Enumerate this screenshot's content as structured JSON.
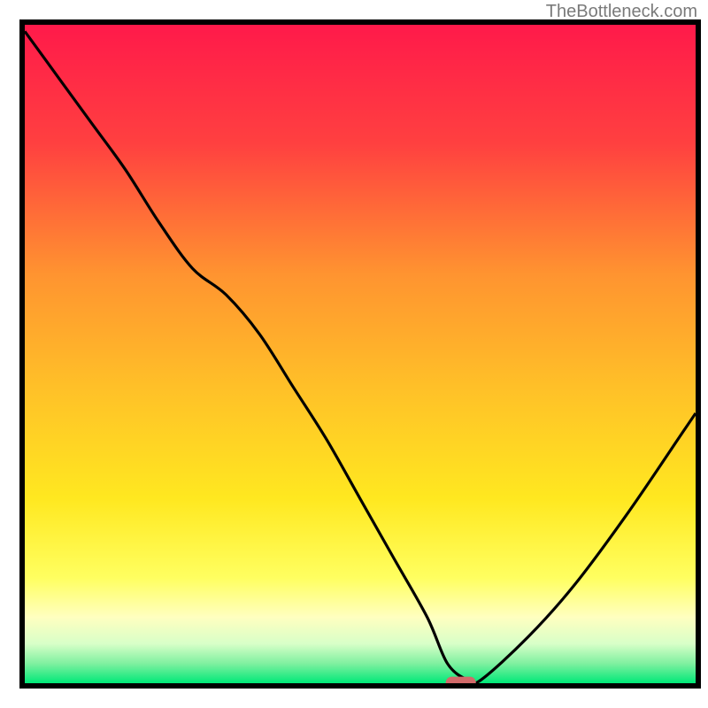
{
  "watermark": "TheBottleneck.com",
  "chart_data": {
    "type": "line",
    "title": "",
    "xlabel": "",
    "ylabel": "",
    "xlim": [
      0,
      100
    ],
    "ylim": [
      0,
      100
    ],
    "background": {
      "type": "vertical-gradient",
      "description": "Red at top through orange, yellow, light-yellow to green band at bottom",
      "stops": [
        {
          "pos": 0.0,
          "color": "#ff1a4a"
        },
        {
          "pos": 0.18,
          "color": "#ff4040"
        },
        {
          "pos": 0.38,
          "color": "#ff9430"
        },
        {
          "pos": 0.55,
          "color": "#ffc028"
        },
        {
          "pos": 0.72,
          "color": "#ffe820"
        },
        {
          "pos": 0.84,
          "color": "#ffff60"
        },
        {
          "pos": 0.9,
          "color": "#ffffc0"
        },
        {
          "pos": 0.94,
          "color": "#d8ffc8"
        },
        {
          "pos": 0.97,
          "color": "#80f0a0"
        },
        {
          "pos": 1.0,
          "color": "#00e878"
        }
      ]
    },
    "series": [
      {
        "name": "bottleneck-curve",
        "color": "#000000",
        "x": [
          0,
          5,
          10,
          15,
          20,
          25,
          30,
          35,
          40,
          45,
          50,
          55,
          60,
          63,
          66,
          68,
          75,
          82,
          90,
          98,
          100
        ],
        "values": [
          99,
          92,
          85,
          78,
          70,
          63,
          59,
          53,
          45,
          37,
          28,
          19,
          10,
          3,
          0.5,
          0.5,
          7,
          15,
          26,
          38,
          41
        ]
      }
    ],
    "marker": {
      "x": 65,
      "y": 0,
      "width": 4.5,
      "height": 1.8,
      "color": "#d26a6a",
      "shape": "rounded"
    },
    "frame": {
      "color": "#000000",
      "width": 6
    }
  }
}
